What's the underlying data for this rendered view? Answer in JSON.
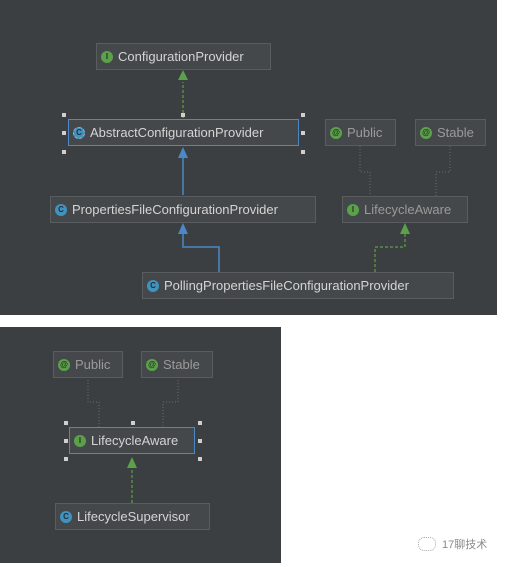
{
  "diagram1": {
    "nodes": {
      "configuration_provider": {
        "label": "ConfigurationProvider",
        "kind": "interface",
        "icon": "interface-icon"
      },
      "abstract_configuration_provider": {
        "label": "AbstractConfigurationProvider",
        "kind": "abstract-class",
        "icon": "abstract-class-icon",
        "selected": true
      },
      "public": {
        "label": "Public",
        "kind": "annotation",
        "icon": "annotation-icon"
      },
      "stable": {
        "label": "Stable",
        "kind": "annotation",
        "icon": "annotation-icon"
      },
      "properties_file_configuration_provider": {
        "label": "PropertiesFileConfigurationProvider",
        "kind": "class",
        "icon": "class-icon"
      },
      "lifecycle_aware": {
        "label": "LifecycleAware",
        "kind": "interface",
        "icon": "interface-icon"
      },
      "polling_properties_file_configuration_provider": {
        "label": "PollingPropertiesFileConfigurationProvider",
        "kind": "class",
        "icon": "class-icon"
      }
    },
    "edges": [
      {
        "from": "AbstractConfigurationProvider",
        "to": "ConfigurationProvider",
        "type": "implements"
      },
      {
        "from": "PropertiesFileConfigurationProvider",
        "to": "AbstractConfigurationProvider",
        "type": "extends"
      },
      {
        "from": "PollingPropertiesFileConfigurationProvider",
        "to": "PropertiesFileConfigurationProvider",
        "type": "extends"
      },
      {
        "from": "PollingPropertiesFileConfigurationProvider",
        "to": "LifecycleAware",
        "type": "implements"
      },
      {
        "from": "LifecycleAware",
        "to": "Public",
        "type": "annotated"
      },
      {
        "from": "LifecycleAware",
        "to": "Stable",
        "type": "annotated"
      }
    ]
  },
  "diagram2": {
    "nodes": {
      "public": {
        "label": "Public",
        "kind": "annotation",
        "icon": "annotation-icon"
      },
      "stable": {
        "label": "Stable",
        "kind": "annotation",
        "icon": "annotation-icon"
      },
      "lifecycle_aware": {
        "label": "LifecycleAware",
        "kind": "interface",
        "icon": "interface-icon",
        "selected": true
      },
      "lifecycle_supervisor": {
        "label": "LifecycleSupervisor",
        "kind": "class",
        "icon": "class-icon"
      }
    },
    "edges": [
      {
        "from": "LifecycleSupervisor",
        "to": "LifecycleAware",
        "type": "implements"
      },
      {
        "from": "LifecycleAware",
        "to": "Public",
        "type": "annotated"
      },
      {
        "from": "LifecycleAware",
        "to": "Stable",
        "type": "annotated"
      }
    ]
  },
  "icons": {
    "interface": "I",
    "class": "C",
    "annotation": "@",
    "abstract": "C"
  },
  "colors": {
    "background": "#3c3f41",
    "extends_edge": "#4a88c7",
    "implements_edge": "#5aa14a",
    "annotation_edge": "#6a6d6f",
    "selection": "#4a88c7"
  },
  "watermark": {
    "text": "17聊技术",
    "icon": "wechat-icon"
  }
}
